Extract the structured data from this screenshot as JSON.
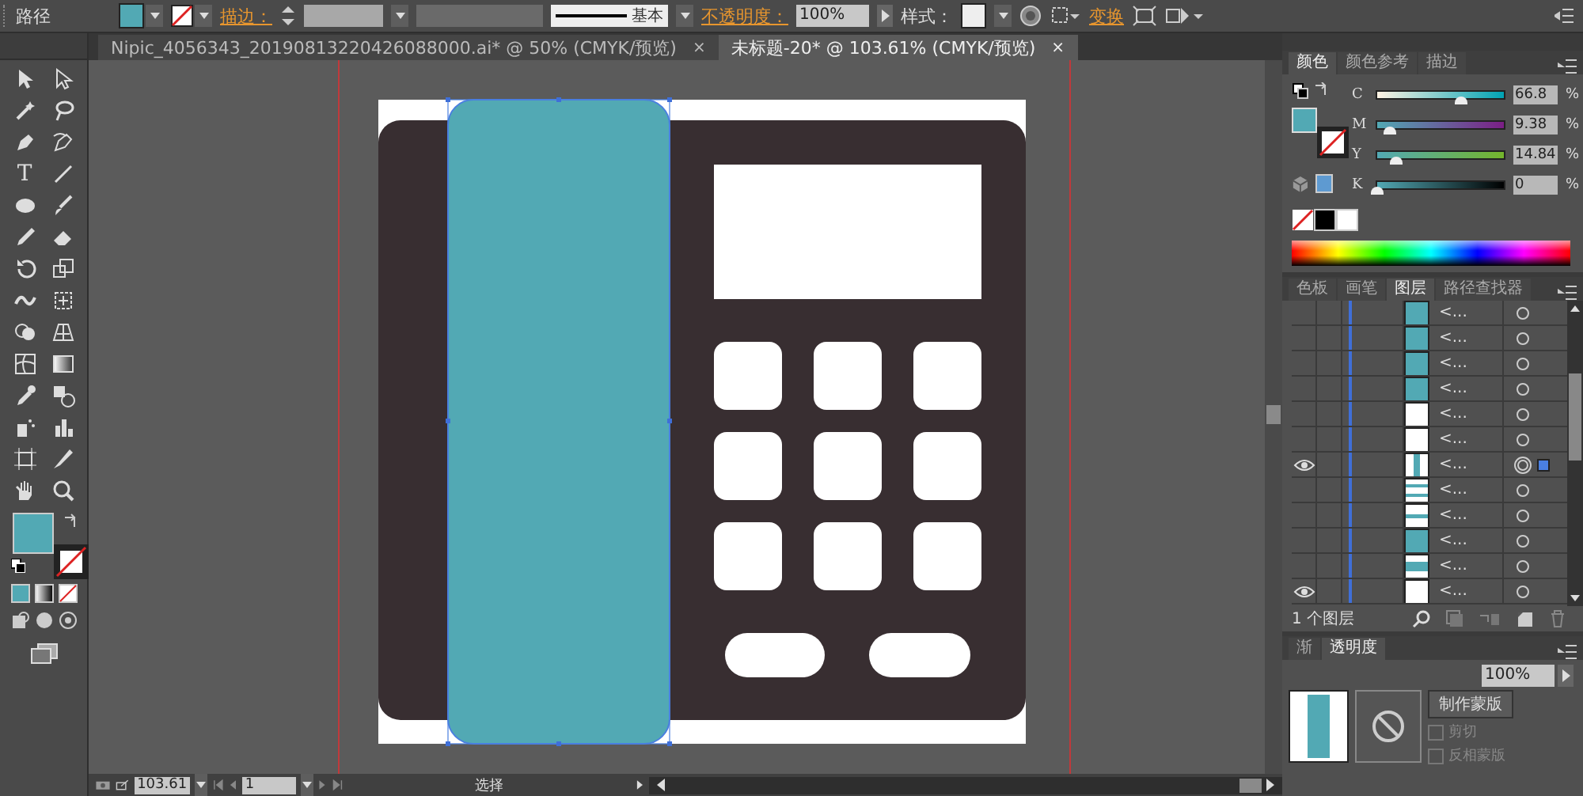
{
  "control_bar": {
    "object_type": "路径",
    "stroke_label": "描边：",
    "line_style": "基本",
    "opacity_label": "不透明度：",
    "opacity": "100%",
    "style_label": "样式：",
    "transform_label": "变换"
  },
  "toolbar": {
    "type_tool": "T"
  },
  "document_tabs": [
    {
      "title": "Nipic_4056343_20190813220426088000.ai* @ 50% (CMYK/预览)",
      "close": "×",
      "selected": false
    },
    {
      "title": "未标题-20* @ 103.61% (CMYK/预览)",
      "close": "×",
      "selected": true
    }
  ],
  "color_panel": {
    "tabs": [
      {
        "label": "颜色",
        "selected": true
      },
      {
        "label": "颜色参考",
        "selected": false
      },
      {
        "label": "描边",
        "selected": false
      }
    ],
    "channels": [
      {
        "name": "C",
        "level": 0.668,
        "value": "66.8",
        "unit": "%"
      },
      {
        "name": "M",
        "level": 0.0938,
        "value": "9.38",
        "unit": "%"
      },
      {
        "name": "Y",
        "level": 0.1484,
        "value": "14.84",
        "unit": "%"
      },
      {
        "name": "K",
        "level": 0,
        "value": "0",
        "unit": "%"
      }
    ]
  },
  "layers_panel": {
    "tabs": [
      {
        "label": "色板",
        "selected": false
      },
      {
        "label": "画笔",
        "selected": false
      },
      {
        "label": "图层",
        "selected": true
      },
      {
        "label": "路径查找器",
        "selected": false
      }
    ],
    "rows": [
      {
        "label": "<...",
        "kind": "teal",
        "visible": false,
        "selected": false
      },
      {
        "label": "<...",
        "kind": "teal",
        "visible": false,
        "selected": false
      },
      {
        "label": "<...",
        "kind": "teal",
        "visible": false,
        "selected": false
      },
      {
        "label": "<...",
        "kind": "teal",
        "visible": false,
        "selected": false
      },
      {
        "label": "<...",
        "kind": "white",
        "visible": false,
        "selected": false
      },
      {
        "label": "<...",
        "kind": "white",
        "visible": false,
        "selected": false
      },
      {
        "label": "<...",
        "kind": "vstripe",
        "visible": true,
        "selected": true
      },
      {
        "label": "<...",
        "kind": "hstripes",
        "visible": false,
        "selected": false
      },
      {
        "label": "<...",
        "kind": "hstripe",
        "visible": false,
        "selected": false
      },
      {
        "label": "<...",
        "kind": "teal",
        "visible": false,
        "selected": false
      },
      {
        "label": "<...",
        "kind": "hband",
        "visible": false,
        "selected": false
      },
      {
        "label": "<...",
        "kind": "white",
        "visible": true,
        "selected": false
      }
    ],
    "count": "1 个图层"
  },
  "transparency_panel": {
    "tabs": [
      {
        "label": "渐",
        "selected": false
      },
      {
        "label": "透明度",
        "selected": true
      }
    ],
    "opacity": "100%",
    "mask_button": "制作蒙版",
    "options": [
      {
        "label": "剪切",
        "checked": false
      },
      {
        "label": "反相蒙版",
        "checked": false
      }
    ]
  },
  "status_bar": {
    "zoom": "103.61",
    "artboard": "1",
    "tool": "选择"
  }
}
